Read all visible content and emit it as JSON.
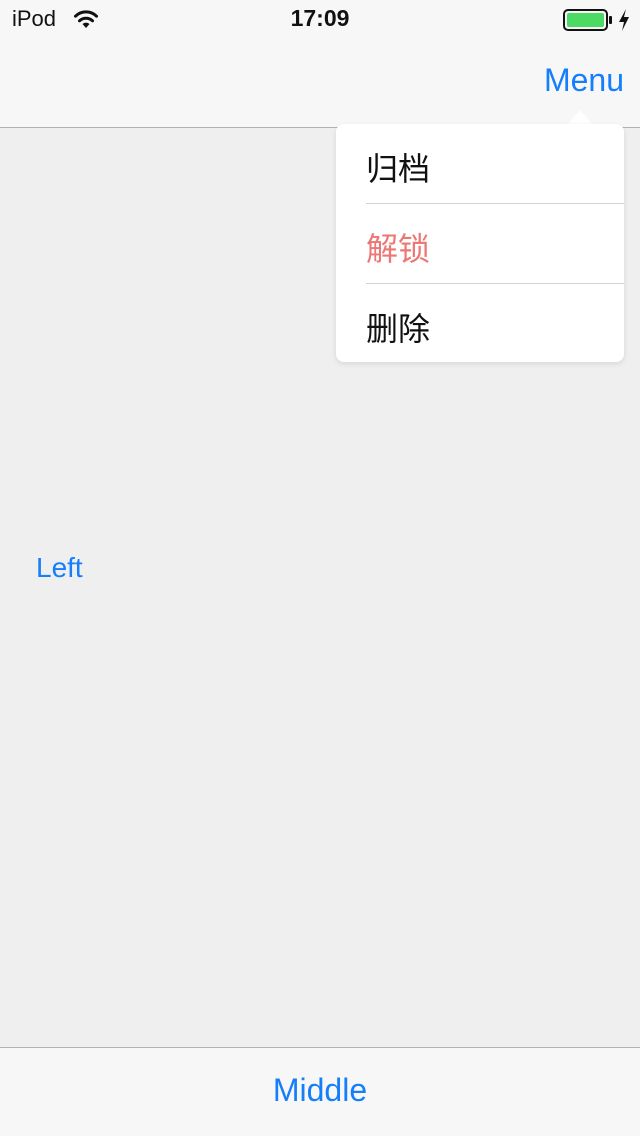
{
  "status_bar": {
    "device": "iPod",
    "time": "17:09",
    "icons": [
      "wifi-icon",
      "battery-icon",
      "charging-bolt-icon"
    ],
    "battery_color": "#4cd964"
  },
  "nav_bar": {
    "menu_label": "Menu"
  },
  "popover_menu": {
    "items": [
      {
        "label": "归档",
        "color": "#111111"
      },
      {
        "label": "解锁",
        "color": "#ec7774"
      },
      {
        "label": "删除",
        "color": "#111111"
      }
    ]
  },
  "content": {
    "left_label": "Left"
  },
  "bottom_bar": {
    "middle_label": "Middle"
  },
  "theme": {
    "accent": "#157efb",
    "background": "#efefef",
    "bar_background": "#f7f7f7"
  }
}
